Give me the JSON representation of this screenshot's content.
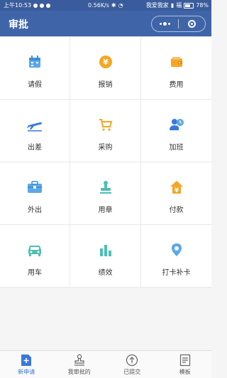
{
  "status_bar": {
    "time": "上午10:53",
    "speed": "0.56K/s",
    "carrier1": "我爱我家",
    "carrier2": "福",
    "battery": "78%"
  },
  "nav": {
    "title": "审批"
  },
  "grid_items": [
    {
      "label": "请假",
      "icon": "calendar-icon",
      "color": "#5aa9e8"
    },
    {
      "label": "报销",
      "icon": "yen-coin-icon",
      "color": "#f5a623"
    },
    {
      "label": "费用",
      "icon": "wallet-icon",
      "color": "#f5a623"
    },
    {
      "label": "出差",
      "icon": "airplane-icon",
      "color": "#3a78d8"
    },
    {
      "label": "采购",
      "icon": "cart-icon",
      "color": "#f5a623"
    },
    {
      "label": "加班",
      "icon": "user-clock-icon",
      "color": "#3a78d8"
    },
    {
      "label": "外出",
      "icon": "briefcase-icon",
      "color": "#5aa9e8"
    },
    {
      "label": "用章",
      "icon": "stamp-icon",
      "color": "#4cc0b4"
    },
    {
      "label": "付款",
      "icon": "yen-house-icon",
      "color": "#f5a623"
    },
    {
      "label": "用车",
      "icon": "car-icon",
      "color": "#4cc0b4"
    },
    {
      "label": "绩效",
      "icon": "bar-chart-icon",
      "color": "#4cc0b4"
    },
    {
      "label": "打卡补卡",
      "icon": "location-pin-icon",
      "color": "#5aa9e8"
    }
  ],
  "tabs": [
    {
      "label": "新申请",
      "icon": "new-document-icon",
      "active": true
    },
    {
      "label": "我审批的",
      "icon": "stamp-outline-icon",
      "active": false
    },
    {
      "label": "已提交",
      "icon": "upload-circle-icon",
      "active": false
    },
    {
      "label": "模板",
      "icon": "template-icon",
      "active": false
    }
  ]
}
